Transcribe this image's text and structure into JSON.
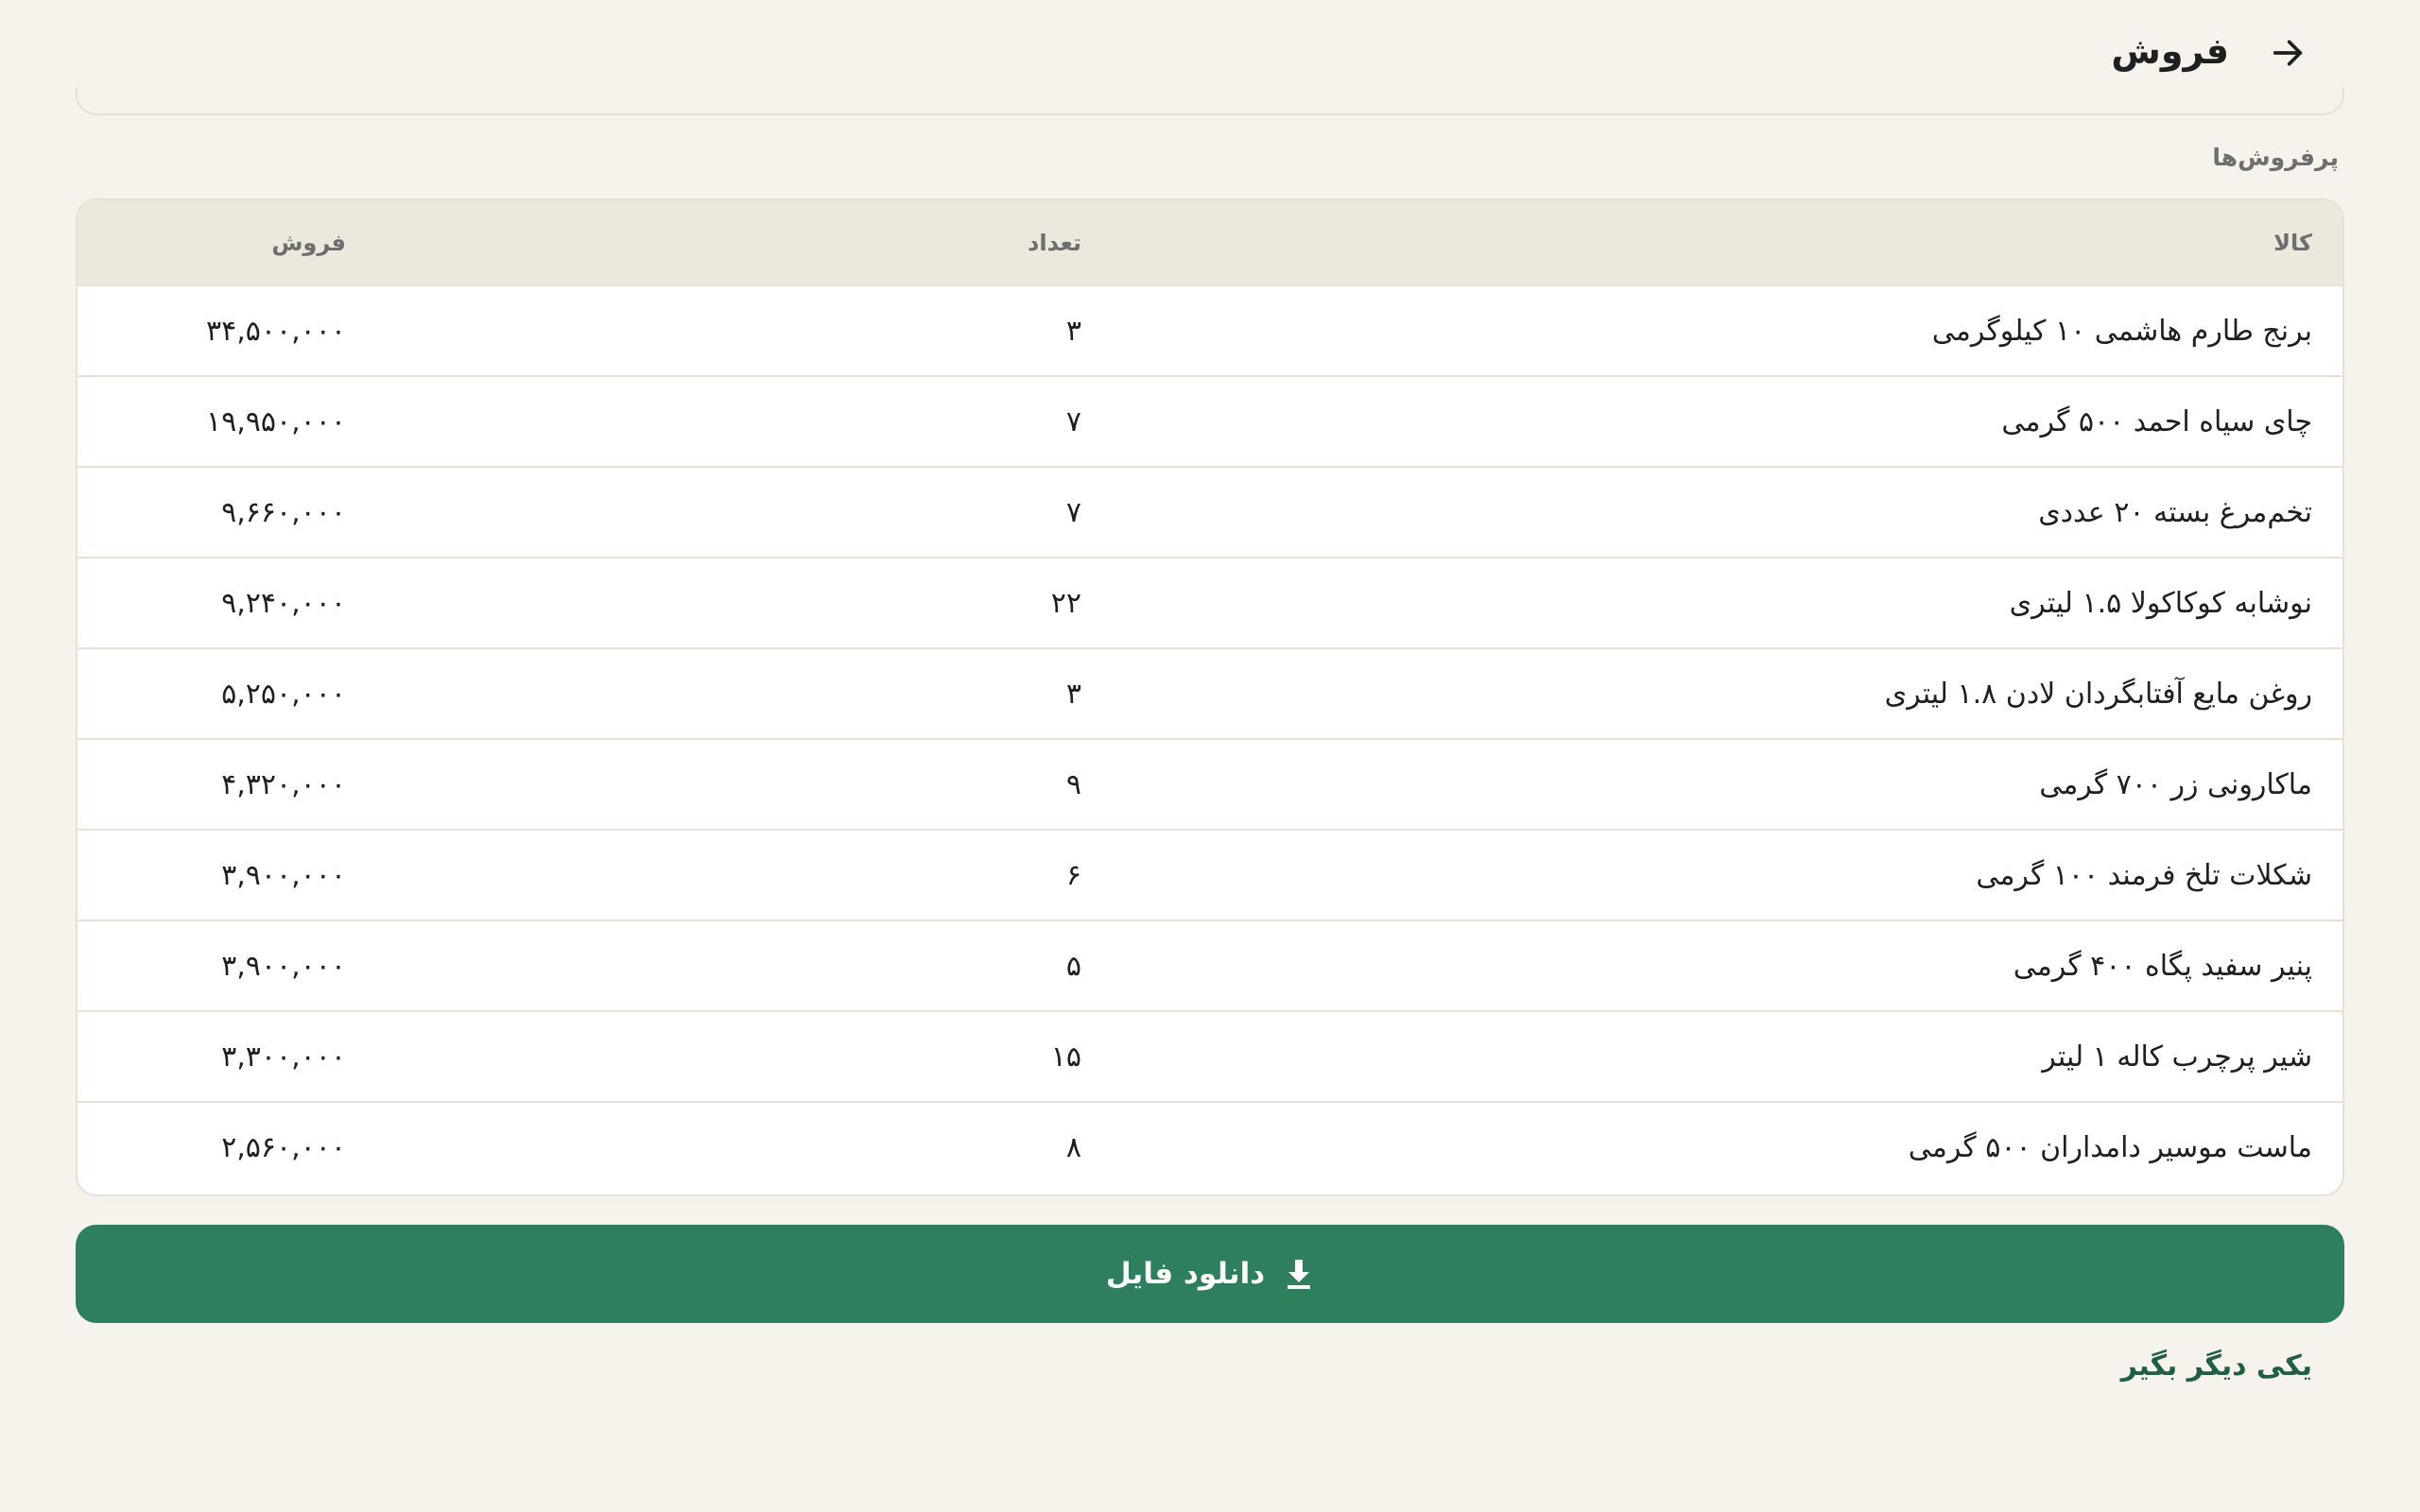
{
  "header": {
    "title": "فروش",
    "back_icon": "arrow-right-icon"
  },
  "section": {
    "label": "پرفروش‌ها"
  },
  "table": {
    "columns": {
      "name": "کالا",
      "quantity": "تعداد",
      "sales": "فروش"
    },
    "rows": [
      {
        "name": "برنج طارم هاشمی ۱۰ کیلوگرمی",
        "quantity": "۳",
        "sales": "۳۴,۵۰۰,۰۰۰"
      },
      {
        "name": "چای سیاه احمد ۵۰۰ گرمی",
        "quantity": "۷",
        "sales": "۱۹,۹۵۰,۰۰۰"
      },
      {
        "name": "تخم‌مرغ بسته ۲۰ عددی",
        "quantity": "۷",
        "sales": "۹,۶۶۰,۰۰۰"
      },
      {
        "name": "نوشابه کوکاکولا ۱.۵ لیتری",
        "quantity": "۲۲",
        "sales": "۹,۲۴۰,۰۰۰"
      },
      {
        "name": "روغن مایع آفتابگردان لادن ۱.۸ لیتری",
        "quantity": "۳",
        "sales": "۵,۲۵۰,۰۰۰"
      },
      {
        "name": "ماکارونی زر ۷۰۰ گرمی",
        "quantity": "۹",
        "sales": "۴,۳۲۰,۰۰۰"
      },
      {
        "name": "شکلات تلخ فرمند ۱۰۰ گرمی",
        "quantity": "۶",
        "sales": "۳,۹۰۰,۰۰۰"
      },
      {
        "name": "پنیر سفید پگاه ۴۰۰ گرمی",
        "quantity": "۵",
        "sales": "۳,۹۰۰,۰۰۰"
      },
      {
        "name": "شیر پرچرب کاله ۱ لیتر",
        "quantity": "۱۵",
        "sales": "۳,۳۰۰,۰۰۰"
      },
      {
        "name": "ماست موسیر دامداران ۵۰۰ گرمی",
        "quantity": "۸",
        "sales": "۲,۵۶۰,۰۰۰"
      }
    ]
  },
  "actions": {
    "download_label": "دانلود فایل",
    "download_icon": "download-icon",
    "another_label": "یکی دیگر بگیر"
  },
  "colors": {
    "background": "#f6f3ec",
    "header_row": "#ece8dd",
    "primary_button": "#2e7f5e",
    "link": "#1f5f47"
  }
}
